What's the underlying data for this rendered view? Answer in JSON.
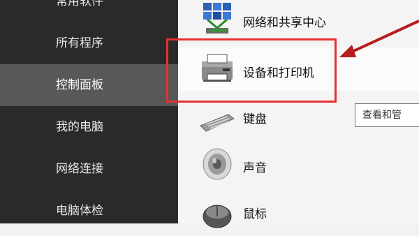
{
  "sidebar": {
    "items": [
      {
        "label": "常用软件"
      },
      {
        "label": "所有程序"
      },
      {
        "label": "控制面板"
      },
      {
        "label": "我的电脑"
      },
      {
        "label": "网络连接"
      },
      {
        "label": "电脑体检"
      }
    ],
    "selected": "控制面板"
  },
  "content": {
    "items": [
      {
        "label": "网络和共享中心",
        "icon": "network-icon"
      },
      {
        "label": "设备和打印机",
        "icon": "printer-icon"
      },
      {
        "label": "键盘",
        "icon": "keyboard-icon"
      },
      {
        "label": "声音",
        "icon": "speaker-icon"
      },
      {
        "label": "鼠标",
        "icon": "mouse-icon"
      }
    ]
  },
  "tooltip": {
    "text": "查看和管"
  },
  "colors": {
    "highlight": "#e53030",
    "sidebar_bg": "#2a2a2a",
    "sidebar_selected": "#585858"
  }
}
